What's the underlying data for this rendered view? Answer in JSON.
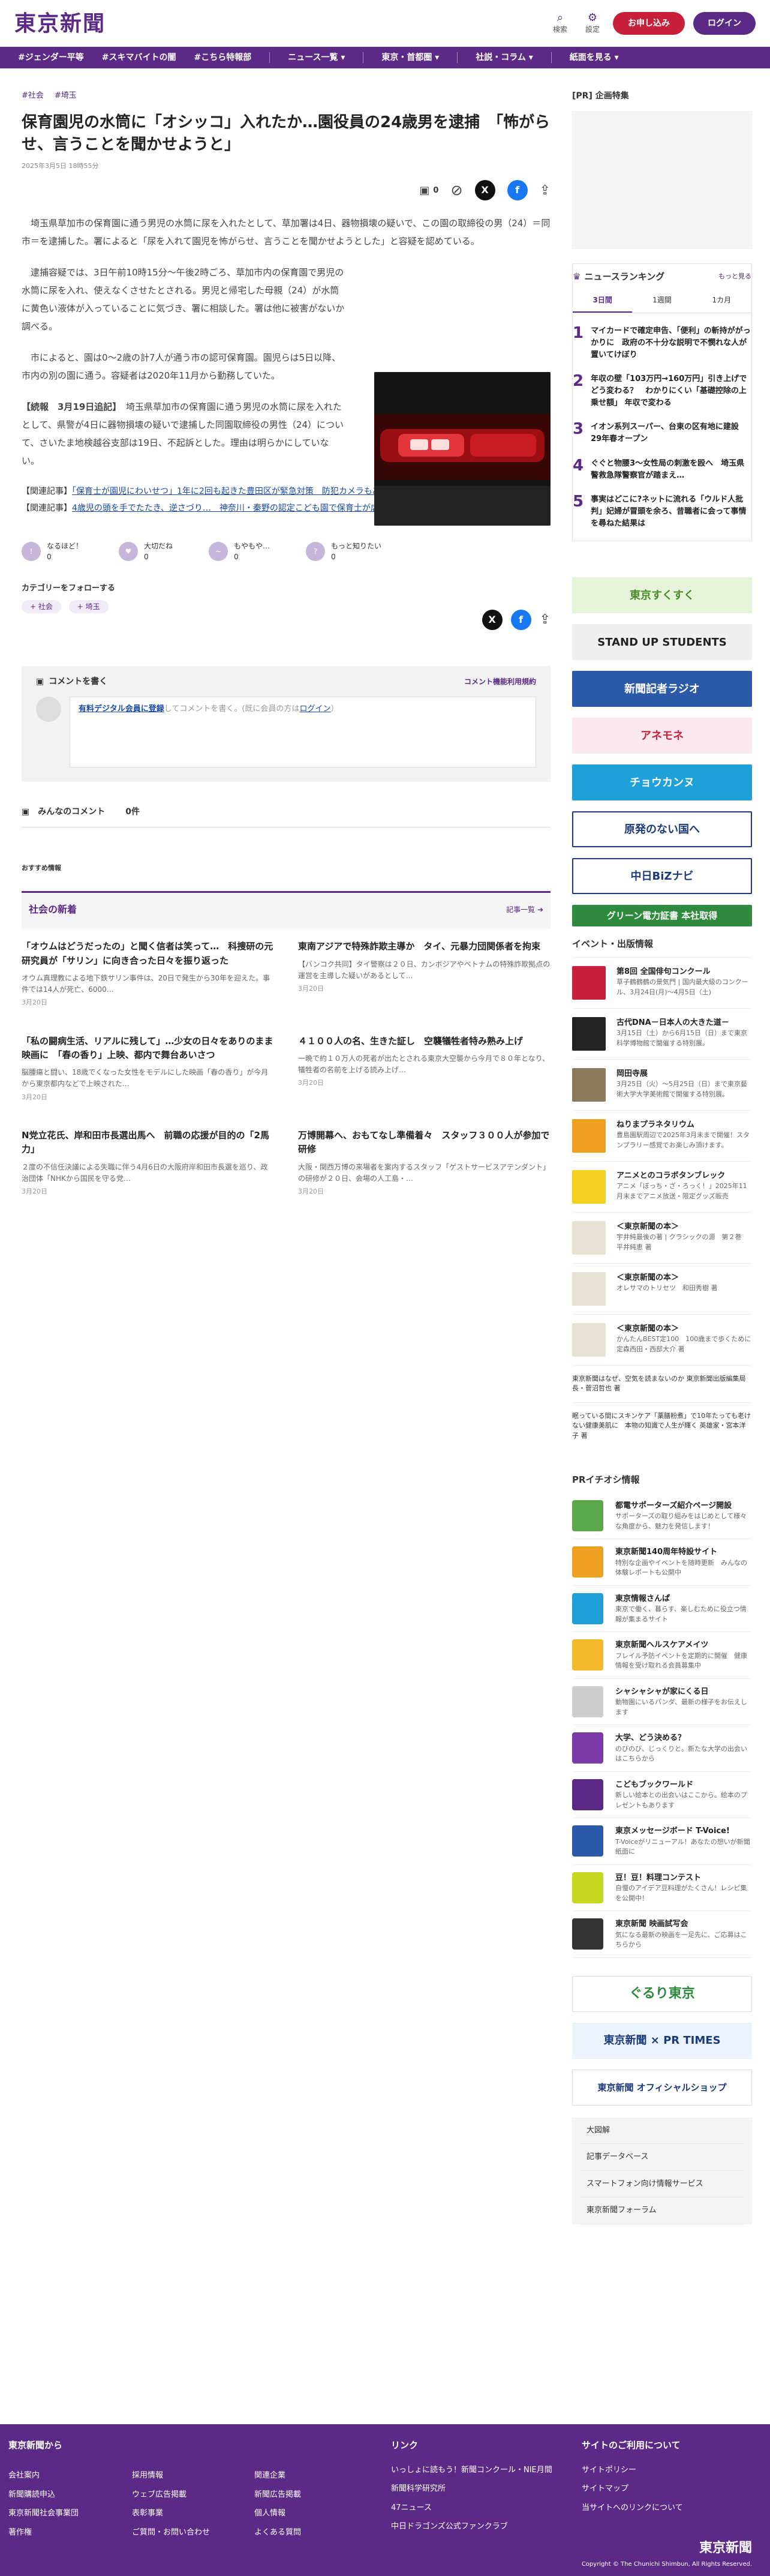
{
  "header": {
    "logo": "東京新聞",
    "search": "検索",
    "settings": "設定",
    "subscribe": "お申し込み",
    "login": "ログイン"
  },
  "nav": [
    "#ジェンダー平等",
    "#スキマバイトの闇",
    "#こちら特報部",
    "ニュース一覧 ▾",
    "東京・首都圏 ▾",
    "社説・コラム ▾",
    "紙面を見る ▾"
  ],
  "article": {
    "tags": [
      "#社会",
      "#埼玉"
    ],
    "title": "保育園児の水筒に「オシッコ」入れたか…園役員の24歳男を逮捕　「怖がらせ、言うことを聞かせようと」",
    "date": "2025年3月5日 18時55分",
    "comment_count": "0",
    "paragraphs": [
      "埼玉県草加市の保育園に通う男児の水筒に尿を入れたとして、草加署は4日、器物損壊の疑いで、この園の取締役の男（24）＝同市＝を逮捕した。署によると「尿を入れて園児を怖がらせ、言うことを聞かせようとした」と容疑を認めている。",
      "逮捕容疑では、3日午前10時15分〜午後2時ごろ、草加市内の保育園で男児の水筒に尿を入れ、使えなくさせたとされる。男児と帰宅した母親（24）が水筒に黄色い液体が入っていることに気づき、署に相談した。署は他に被害がないか調べる。",
      "市によると、園は0〜2歳の計7人が通う市の認可保育園。園児らは5日以降、市内の別の園に通う。容疑者は2020年11月から勤務していた。"
    ],
    "followup_label": "【続報　3月19日追記】",
    "followup_text": "埼玉県草加市の保育園に通う男児の水筒に尿を入れたとして、県警が4日に器物損壊の疑いで逮捕した同園取締役の男性（24）について、さいたま地検越谷支部は19日、不起訴とした。理由は明らかにしていない。",
    "related": [
      {
        "label": "【関連記事】",
        "text": "「保育士が園児にわいせつ」1年に2回も起きた豊田区が緊急対策　防犯カメラもあったのになぜ…どう防ぐ？"
      },
      {
        "label": "【関連記事】",
        "text": "4歳児の頭を手でたたき、逆さづり…　神奈川・秦野の認定こども園で保育士が虐待、第三者委員会が認定"
      }
    ],
    "reactions": [
      {
        "label": "なるほど！",
        "count": "0"
      },
      {
        "label": "大切だね",
        "count": "0"
      },
      {
        "label": "もやもや…",
        "count": "0"
      },
      {
        "label": "もっと知りたい",
        "count": "0"
      }
    ],
    "follow_label": "カテゴリーをフォローする",
    "follow_chips": [
      "+ 社会",
      "+ 埼玉"
    ]
  },
  "comments": {
    "write_label": "コメントを書く",
    "terms_link": "コメント機能利用規約",
    "prompt_link": "有料デジタル会員に登録",
    "prompt_text": "してコメントを書く。(既に会員の方は",
    "prompt_login": "ログイン",
    "prompt_end": "）",
    "all_label": "みんなのコメント",
    "all_count": "0件"
  },
  "recommend_label": "おすすめ情報",
  "social_news": {
    "title": "社会の新着",
    "more": "記事一覧",
    "items": [
      {
        "title": "「オウムはどうだったの」と聞く信者は笑って…　科捜研の元研究員が「サリン」に向き合った日々を振り返った",
        "desc": "オウム真理教による地下鉄サリン事件は、20日で発生から30年を迎えた。事件では14人が死亡、6000…",
        "date": "3月20日"
      },
      {
        "title": "東南アジアで特殊詐欺主導か　タイ、元暴力団関係者を拘束",
        "desc": "【バンコク共同】タイ警察は２０日、カンボジアやベトナムの特殊詐欺拠点の運営を主導した疑いがあるとして…",
        "date": "3月20日"
      },
      {
        "title": "「私の闘病生活、リアルに残して」…少女の日々をありのまま映画に　「春の香り」上映、都内で舞台あいさつ",
        "desc": "脳腫瘍と闘い、18歳でくなった女性をモデルにした映画「春の香り」が今月から東京都内などで上映された…",
        "date": "3月20日"
      },
      {
        "title": "４１００人の名、生きた証し　空襲犠牲者特み熟み上げ",
        "desc": "一晩で約１０万人の死者が出たとされる東京大空襲から今月で８０年となり、犠牲者の名前を上げる読み上げ…",
        "date": "3月20日"
      },
      {
        "title": "N党立花氏、岸和田市長選出馬へ　前職の応援が目的の「2馬力」",
        "desc": "２度の不信任決議による失職に伴う4月6日の大阪府岸和田市長選を巡り、政治団体「NHKから国民を守る党…",
        "date": "3月20日"
      },
      {
        "title": "万博開幕へ、おもてなし準備着々　スタッフ３００人が参加で研修",
        "desc": "大阪・関西万博の来場者を案内するスタッフ「ゲストサービスアテンダント」の研修が２０日、会場の人工島・…",
        "date": "3月20日"
      }
    ]
  },
  "sidebar": {
    "pr_label": "[PR] 企画特集",
    "ranking_title": "ニュースランキング",
    "ranking_more": "もっと見る",
    "ranking_tabs": [
      "3日間",
      "1週間",
      "1カ月"
    ],
    "ranking": [
      {
        "n": "1",
        "t": "マイカードで確定申告、「便利」の斬持ががっかりに　政府の不十分な説明で不憫れな人が置いてけぼり"
      },
      {
        "n": "2",
        "t": "年収の壁「103万円→160万円」引き上げで どう変わる？　わかりにくい「基礎控除の上乗せ額」 年収で変わる"
      },
      {
        "n": "3",
        "t": "イオン系列スーパー、台東の区有地に建設 29年春オープン"
      },
      {
        "n": "4",
        "t": "ぐぐと物腰3～女性局の刺激を殴へ　埼玉県警救急隊警察官が踏まえ…"
      },
      {
        "n": "5",
        "t": "事実はどこに?ネットに流れる「ウルド人批判」妃婦が冒頭を余ろ、昔職者に会って事情を尋ねた結果は"
      }
    ],
    "banners": [
      "東京すくすく",
      "STAND UP STUDENTS",
      "新聞記者ラジオ",
      "アネモネ",
      "チョウカンヌ",
      "原発のない国へ",
      "中日BiZナビ",
      "グリーン電力証書 本社取得"
    ],
    "events_title": "イベント・出版情報",
    "events": [
      {
        "h": "第8回 全国俳句コンクール",
        "p": "草子鶴鶴鶴の景気門 | 国内最大級のコンクール、3月24日(月)～4月5日（土)"
      },
      {
        "h": "古代DNA－日本人の大きた道－",
        "p": "3月15日（土）から6月15日（日）まで東京科学博物館で開催する特別展。"
      },
      {
        "h": "岡田寺展",
        "p": "3月25日（火）～5月25日（日）まで東京藝術大学大学美術館で開催する特別展。"
      },
      {
        "h": "ねりまプラネタリウム",
        "p": "豊島園駅周辺で2025年3月末まで開催！スタンプラリー感覚でお楽しみ頂けます。"
      },
      {
        "h": "アニメとのコラボタンブレック",
        "p": "アニメ「ぼっち・ざ・ろっく！」2025年11月末までアニメ放送・限定グッズ販売"
      },
      {
        "h": "＜東京新聞の本＞",
        "p": "宇井純最後の著 | クラシックの源　第２巻　平井純恵 著"
      },
      {
        "h": "＜東京新聞の本＞",
        "p": "オレサマのトリセツ　和田秀樹 著"
      },
      {
        "h": "＜東京新聞の本＞",
        "p": "かんたんBEST定100　100歳まで歩くために　定森西田・西部大介 著"
      }
    ],
    "book_links": [
      "東京新聞はなぜ、空気を読まないのか 東京新聞出版編集局長・菅沼哲也 著",
      "眠っている間にスキンケア「薬膳粉煮」で10年たっても老けない健康美肌に　本物の知識で人生が輝く 英雄家・宮本洋子 著"
    ],
    "pr_title": "PRイチオシ情報",
    "pr_items": [
      {
        "h": "都電サポーターズ紹介ページ開設",
        "p": "サポーターズの取り組みをはじめとして様々な角度から、魅力を発信します！"
      },
      {
        "h": "東京新聞140周年特設サイト",
        "p": "特別な企画やイベントを随時更新　みんなの体験レポートも公開中"
      },
      {
        "h": "東京情報さんぱ",
        "p": "東京で働く、暮らす、楽しむために役立つ情報が集まるサイト"
      },
      {
        "h": "東京新聞ヘルスケアメイツ",
        "p": "フレイル予防イベントを定期的に開催　健康情報を受け取れる会員募集中"
      },
      {
        "h": "シャシャシャが家にくる日",
        "p": "動物園にいるパンダ、最新の様子をお伝えします"
      },
      {
        "h": "大学、どう決める？",
        "p": "のびのび、じっくりと。新たな大学の出会いはこちらから"
      },
      {
        "h": "こどもブックワールド",
        "p": "新しい絵本との出会いはここから。絵本のプレゼントもあります"
      },
      {
        "h": "東京メッセージボード T-Voice!",
        "p": "T-Voiceがリニューアル！あなたの想いが新聞紙面に"
      },
      {
        "h": "豆！豆！料理コンテスト",
        "p": "自慢のアイデア豆料理がたくさん！レシピ集を公開中！"
      },
      {
        "h": "東京新聞 映画試写会",
        "p": "気になる最新の映画を一足先に、ご応募はこちらから"
      }
    ],
    "bottom_banners": [
      "ぐるり東京",
      "東京新聞 × PR TIMES",
      "東京新聞 オフィシャルショップ"
    ],
    "links": [
      "大図解",
      "記事データベース",
      "スマートフォン向け情報サービス",
      "東京新聞フォーラム"
    ]
  },
  "footer": {
    "col1_title": "東京新聞から",
    "col1a": [
      "会社案内",
      "新聞購読申込",
      "東京新聞社会事業団",
      "著作権"
    ],
    "col1b": [
      "採用情報",
      "ウェブ広告掲載",
      "表彰事業",
      "ご質問・お問い合わせ"
    ],
    "col1c": [
      "関連企業",
      "新聞広告掲載",
      "個人情報",
      "よくある質問"
    ],
    "col2_title": "リンク",
    "col2": [
      "いっしょに読もう！新聞コンクール・NIE月間",
      "新聞科学研究所",
      "47ニュース",
      "中日ドラゴンズ公式ファンクラブ"
    ],
    "col3_title": "サイトのご利用について",
    "col3": [
      "サイトポリシー",
      "サイトマップ",
      "当サイトへのリンクについて"
    ],
    "logo": "東京新聞",
    "copyright": "Copyright © The Chunichi Shimbun, All Rights Reserved."
  },
  "colors": {
    "brand": "#5b2a86",
    "subscribe": "#c8203a"
  }
}
